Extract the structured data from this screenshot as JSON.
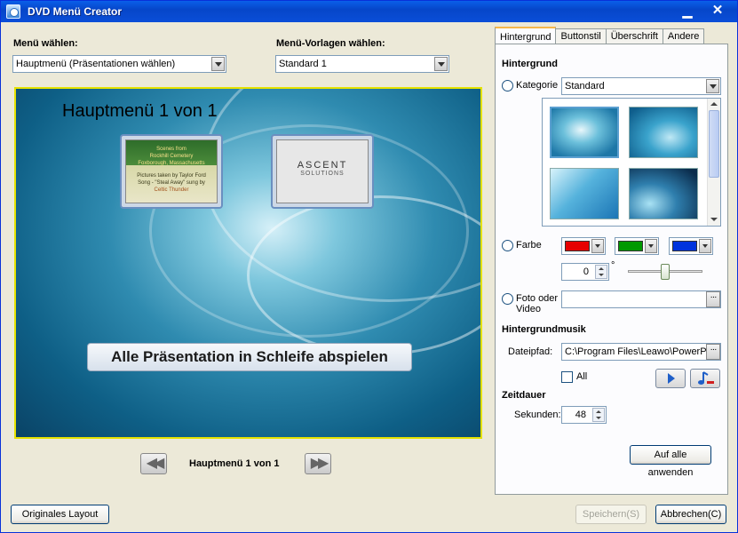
{
  "window": {
    "title": "DVD Menü Creator"
  },
  "left": {
    "menu_label": "Menü wählen:",
    "menu_value": "Hauptmenü (Präsentationen wählen)",
    "template_label": "Menü-Vorlagen wählen:",
    "template_value": "Standard 1",
    "preview_title": "Hauptmenü 1 von 1",
    "thumb1_lines": [
      "Scenes from",
      "Rockhill Cemetery",
      "Foxborough, Massachusetts",
      "Pictures taken by Taylor Ford",
      "Song - \"Steal Away\" sung by",
      "Celtic Thunder"
    ],
    "thumb2_text": "ASCENT",
    "thumb2_sub": "SOLUTIONS",
    "play_all": "Alle Präsentation in Schleife abspielen",
    "page_label": "Hauptmenü 1 von 1"
  },
  "tabs": [
    "Hintergrund",
    "Buttonstil",
    "Überschrift",
    "Andere"
  ],
  "panel": {
    "bg_section": "Hintergrund",
    "kategorie_label": "Kategorie",
    "kategorie_value": "Standard",
    "farbe_label": "Farbe",
    "colors": [
      "#e60000",
      "#009900",
      "#0033dd"
    ],
    "angle_value": "0",
    "angle_unit": "°",
    "foto_label_1": "Foto oder",
    "foto_label_2": "Video",
    "foto_value": "",
    "music_section": "Hintergrundmusik",
    "dateipfad_label": "Dateipfad:",
    "dateipfad_value": "C:\\Program Files\\Leawo\\PowerPoint",
    "all_label": "All",
    "zeit_section": "Zeitdauer",
    "sekunden_label": "Sekunden:",
    "sekunden_value": "48",
    "apply_all": "Auf alle anwenden"
  },
  "footer": {
    "original_layout": "Originales Layout",
    "save": "Speichern(S)",
    "cancel": "Abbrechen(C)"
  }
}
